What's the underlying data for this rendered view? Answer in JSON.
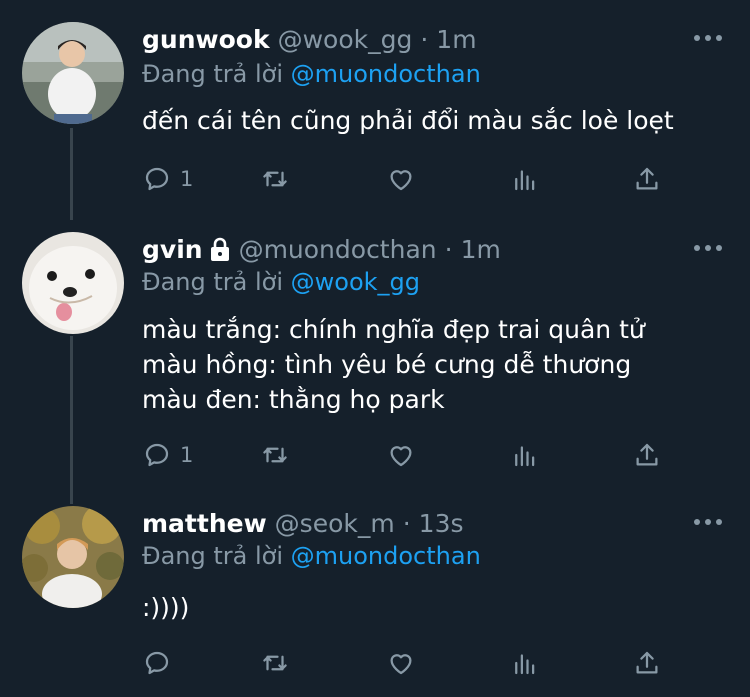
{
  "reply_prefix": "Đang trả lời",
  "tweets": [
    {
      "name": "gunwook",
      "handle": "@wook_gg",
      "dot": "·",
      "time": "1m",
      "reply_to": "@muondocthan",
      "text": "đến cái tên cũng phải đổi màu sắc loè loẹt",
      "reply_count": "1",
      "protected": false
    },
    {
      "name": "gvin",
      "handle": "@muondocthan",
      "dot": "·",
      "time": "1m",
      "reply_to": "@wook_gg",
      "text": "màu trắng: chính nghĩa đẹp trai quân tử\nmàu hồng: tình yêu bé cưng dễ thương\nmàu đen: thằng họ park",
      "reply_count": "1",
      "protected": true
    },
    {
      "name": "matthew",
      "handle": "@seok_m",
      "dot": "·",
      "time": "13s",
      "reply_to": "@muondocthan",
      "text": ":))))",
      "reply_count": "",
      "protected": false
    }
  ],
  "colors": {
    "background": "#15202b",
    "secondary_text": "#8899a6",
    "mention": "#1da1f2",
    "thread_line": "#38444d"
  },
  "icons": [
    "reply-icon",
    "retweet-icon",
    "like-icon",
    "analytics-icon",
    "share-icon",
    "more-icon",
    "lock-icon"
  ]
}
